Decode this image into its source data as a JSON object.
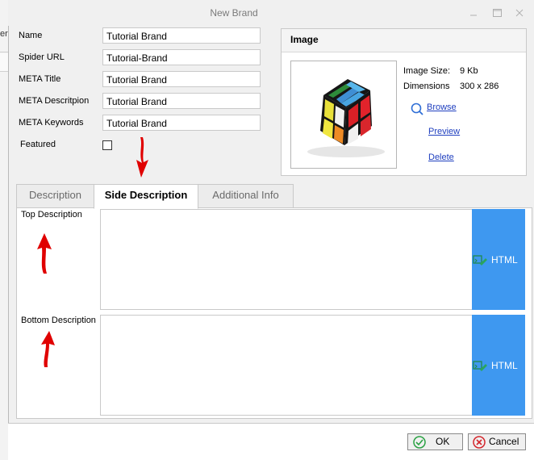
{
  "background": {
    "fragment": "er"
  },
  "window": {
    "title": "New Brand",
    "minimize_glyph": "🗕",
    "maximize_glyph": "🗖",
    "close_glyph": "✕"
  },
  "form": {
    "fields": [
      {
        "label": "Name",
        "value": "Tutorial Brand"
      },
      {
        "label": "Spider URL",
        "value": "Tutorial-Brand"
      },
      {
        "label": "META Title",
        "value": "Tutorial Brand"
      },
      {
        "label": "META Descritpion",
        "value": "Tutorial Brand"
      },
      {
        "label": "META Keywords",
        "value": "Tutorial Brand"
      }
    ],
    "featured": {
      "label": "Featured",
      "checked": false
    }
  },
  "image_panel": {
    "title": "Image",
    "size_label": "Image Size:",
    "size_value": "9 Kb",
    "dimensions_label": "Dimensions",
    "dimensions_value": "300 x 286",
    "browse": "Browse",
    "preview": "Preview",
    "delete": "Delete"
  },
  "tabs": [
    {
      "label": "Description",
      "active": false
    },
    {
      "label": "Side Description",
      "active": true
    },
    {
      "label": "Additional Info",
      "active": false
    }
  ],
  "side_description": {
    "top_label": "Top Description",
    "bottom_label": "Bottom Description",
    "html_button": "HTML"
  },
  "footer": {
    "ok": "OK",
    "cancel": "Cancel"
  },
  "colors": {
    "annotation_arrow": "#e00000",
    "html_button": "#3e98f0",
    "link": "#1f3fbf"
  }
}
